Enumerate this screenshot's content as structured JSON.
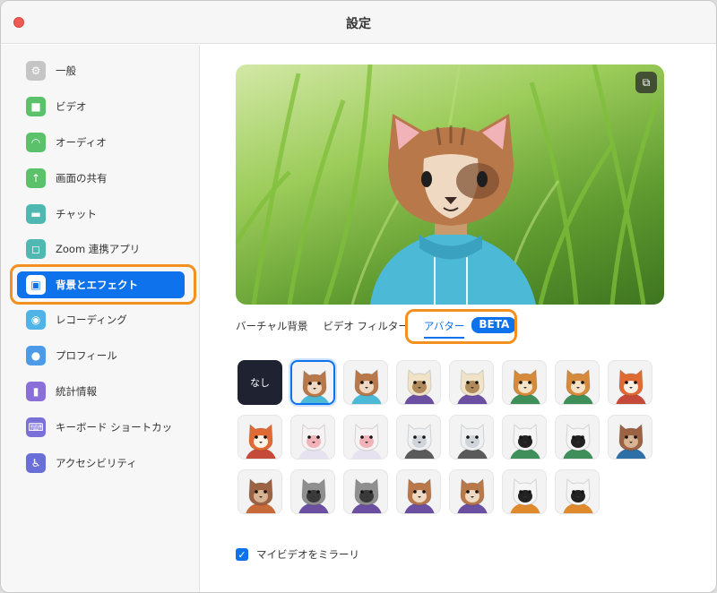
{
  "window": {
    "title": "設定"
  },
  "sidebar": {
    "items": [
      {
        "label": "一般",
        "icon": "gear-icon",
        "color": "#c5c5c5",
        "glyph": "⚙"
      },
      {
        "label": "ビデオ",
        "icon": "video-camera-icon",
        "color": "#5cc16b",
        "glyph": "■"
      },
      {
        "label": "オーディオ",
        "icon": "headphones-icon",
        "color": "#5cc16b",
        "glyph": "◠"
      },
      {
        "label": "画面の共有",
        "icon": "share-screen-icon",
        "color": "#5cc16b",
        "glyph": "↑"
      },
      {
        "label": "チャット",
        "icon": "chat-bubble-icon",
        "color": "#4fb8b0",
        "glyph": "▬"
      },
      {
        "label": "Zoom 連携アプリ",
        "icon": "apps-icon",
        "color": "#4fb8b0",
        "glyph": "◻"
      },
      {
        "label": "背景とエフェクト",
        "icon": "background-effects-icon",
        "color": "#ffffff",
        "glyph": "▣"
      },
      {
        "label": "レコーディング",
        "icon": "record-icon",
        "color": "#4fb3e8",
        "glyph": "◉"
      },
      {
        "label": "プロフィール",
        "icon": "profile-icon",
        "color": "#4c9be8",
        "glyph": "●"
      },
      {
        "label": "統計情報",
        "icon": "statistics-icon",
        "color": "#8a6fd8",
        "glyph": "▮"
      },
      {
        "label": "キーボード ショートカッ",
        "icon": "keyboard-icon",
        "color": "#7b6fd8",
        "glyph": "⌨"
      },
      {
        "label": "アクセシビリティ",
        "icon": "accessibility-icon",
        "color": "#6a6fd8",
        "glyph": "♿"
      }
    ],
    "active_index": 6
  },
  "preview": {
    "expand_icon": "expand-icon",
    "expand_glyph": "⧉"
  },
  "tabs": [
    {
      "label": "バーチャル背景",
      "active": false
    },
    {
      "label": "ビデオ フィルター",
      "active": false
    },
    {
      "label": "アバター",
      "active": true,
      "badge": "BETA"
    }
  ],
  "avatars": {
    "none_label": "なし",
    "items": [
      "cat-brown-avatar",
      "cat-tan-avatar",
      "cow-avatar",
      "cow-avatar-2",
      "dog-orange-avatar",
      "dog-brown-avatar",
      "fox-avatar",
      "fox-avatar-2",
      "rabbit-avatar",
      "rabbit-avatar-2",
      "polar-bear-avatar",
      "polar-bear-avatar-2",
      "panda-avatar",
      "panda-avatar-2",
      "beaver-avatar",
      "beaver-avatar-2",
      "raccoon-avatar",
      "raccoon-avatar-2",
      "cat-gray-avatar",
      "cat-gray-avatar-2",
      "cow-bw-avatar",
      "cow-bw-avatar-2"
    ],
    "selected_index": 0
  },
  "mirror": {
    "label": "マイビデオをミラーリ",
    "checked": true
  },
  "colors": {
    "accent": "#0e72ed",
    "highlight": "#f4901e"
  }
}
